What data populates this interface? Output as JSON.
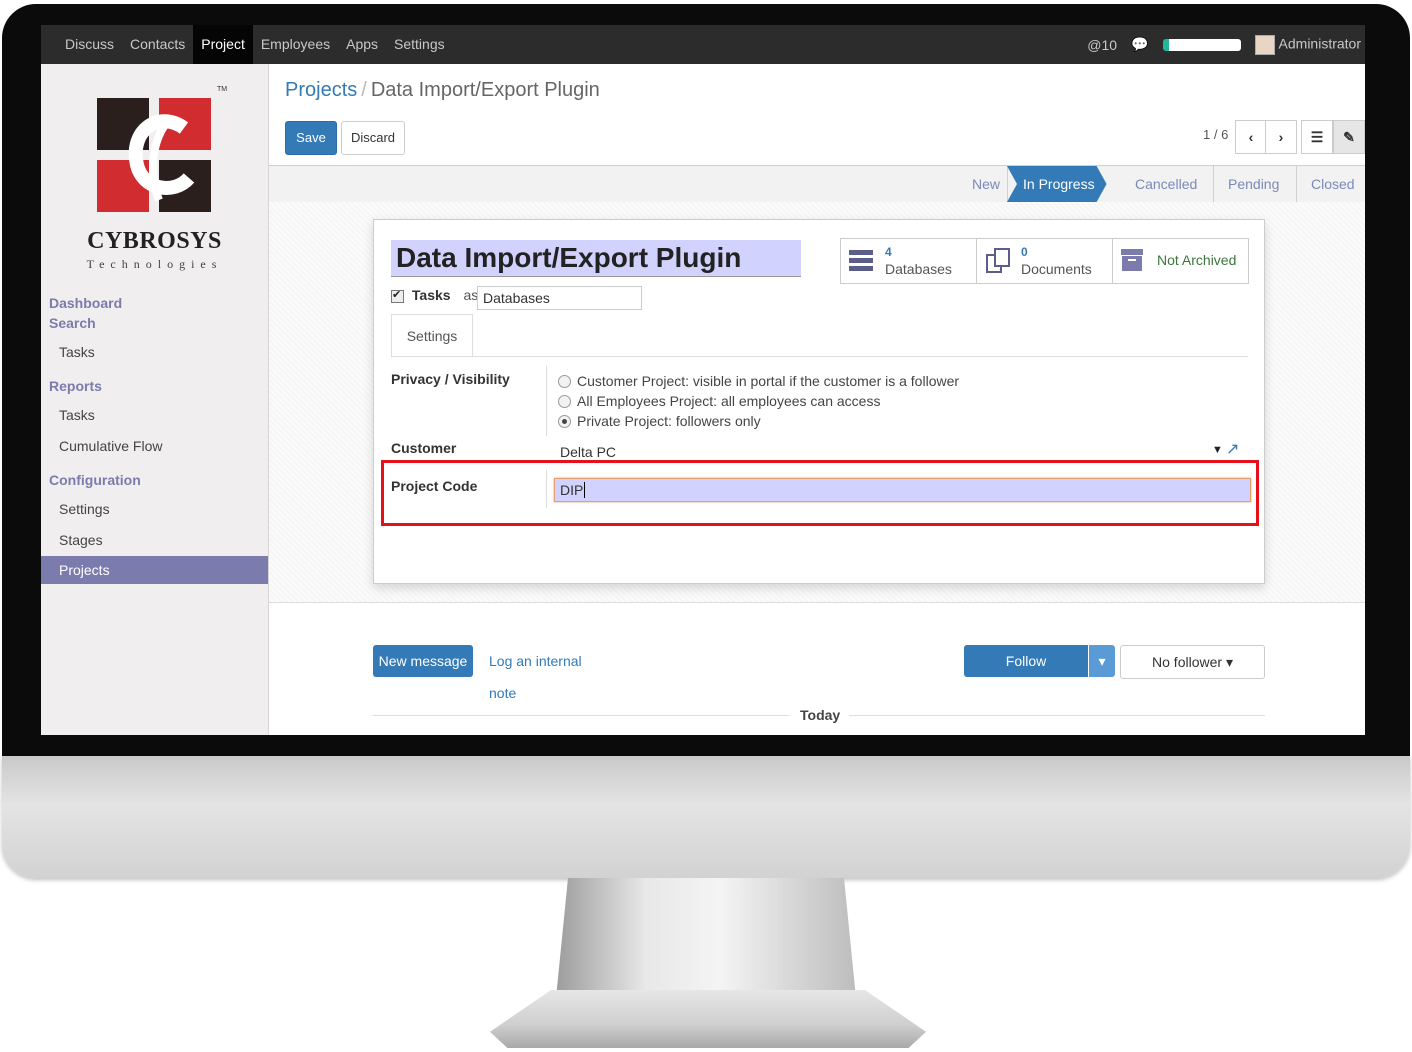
{
  "topbar": {
    "menu": [
      "Discuss",
      "Contacts",
      "Project",
      "Employees",
      "Apps",
      "Settings"
    ],
    "active": "Project",
    "mentions_count": "10",
    "user": "Administrator"
  },
  "sidebar": {
    "brand_name": "CYBROSYS",
    "brand_sub": "Technologies",
    "brand_tm": "TM",
    "sections": [
      {
        "heading": "Dashboard"
      },
      {
        "heading": "Search",
        "items": [
          "Tasks"
        ]
      },
      {
        "heading": "Reports",
        "items": [
          "Tasks",
          "Cumulative Flow"
        ]
      },
      {
        "heading": "Configuration",
        "items": [
          "Settings",
          "Stages",
          "Projects"
        ]
      }
    ],
    "active_item": "Projects"
  },
  "breadcrumb": {
    "parent": "Projects",
    "separator": "/",
    "current": "Data Import/Export Plugin"
  },
  "toolbar": {
    "save": "Save",
    "discard": "Discard",
    "pager": "1 / 6"
  },
  "stages": [
    "New",
    "In Progress",
    "Cancelled",
    "Pending",
    "Closed"
  ],
  "active_stage": "In Progress",
  "form": {
    "title": "Data Import/Export Plugin",
    "stats": [
      {
        "count": "4",
        "label": "Databases",
        "icon": "database-icon"
      },
      {
        "count": "0",
        "label": "Documents",
        "icon": "documents-icon"
      },
      {
        "count": "",
        "label": "Not Archived",
        "icon": "archive-icon"
      }
    ],
    "tasks_label": "Tasks",
    "tasks_as": "as",
    "tasks_alias": "Databases",
    "tab": "Settings",
    "privacy_label": "Privacy / Visibility",
    "privacy_options": [
      "Customer Project: visible in portal if the customer is a follower",
      "All Employees Project: all employees can access",
      "Private Project: followers only"
    ],
    "privacy_selected": 2,
    "customer_label": "Customer",
    "customer_value": "Delta PC",
    "project_code_label": "Project Code",
    "project_code_value": "DIP"
  },
  "chatter": {
    "new_message": "New message",
    "log_note": "Log an internal note",
    "follow": "Follow",
    "followers": "No follower",
    "today": "Today"
  },
  "colors": {
    "accent": "#337ab7",
    "sidebar_active": "#7c7bad",
    "highlight_box": "#e5101a",
    "input_required": "#d2d2ff"
  }
}
